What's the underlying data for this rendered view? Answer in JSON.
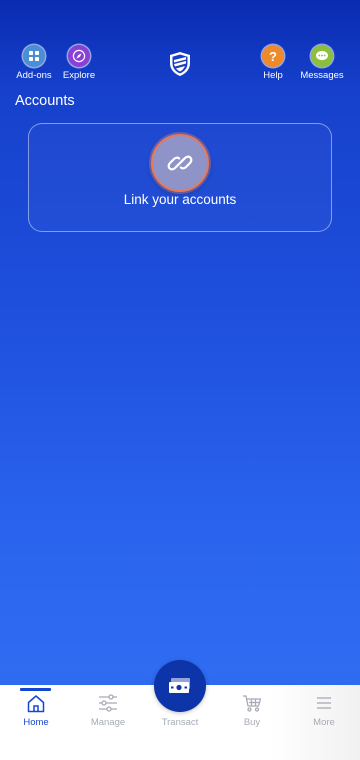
{
  "header": {
    "addons_label": "Add-ons",
    "explore_label": "Explore",
    "help_label": "Help",
    "messages_label": "Messages",
    "logo_icon": "shield-logo-icon"
  },
  "accounts": {
    "title": "Accounts",
    "link_label": "Link your accounts",
    "link_icon": "chain-link-icon"
  },
  "bottom_nav": {
    "home_label": "Home",
    "manage_label": "Manage",
    "transact_label": "Transact",
    "buy_label": "Buy",
    "more_label": "More",
    "active_tab": "Home"
  },
  "colors": {
    "brand_blue": "#1446d2",
    "addons": "#4a8fd6",
    "explore": "#8a3fd6",
    "help": "#ef8a2a",
    "messages": "#8cbf3a",
    "link_accent": "#e8785a"
  }
}
